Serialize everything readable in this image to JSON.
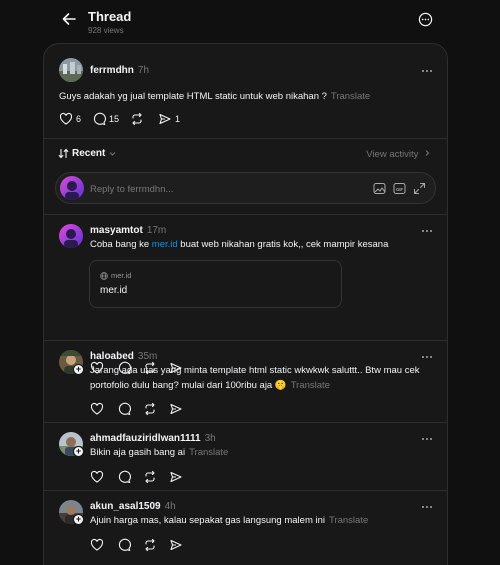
{
  "header": {
    "title": "Thread",
    "views": "928 views"
  },
  "main_post": {
    "username": "ferrmdhn",
    "time": "7h",
    "text": "Guys adakah yg jual template HTML static untuk web nikahan ?",
    "translate": "Translate",
    "likes": "6",
    "comments": "15",
    "shares": "1"
  },
  "sort": {
    "label": "Recent",
    "view_activity": "View activity"
  },
  "reply_box": {
    "placeholder": "Reply to ferrmdhn..."
  },
  "replies": [
    {
      "username": "masyamtot",
      "time": "17m",
      "text_before": "Coba bang ke ",
      "link_text": "mer.id",
      "text_after": " buat web nikahan gratis kok,, cek mampir kesana",
      "link_card": {
        "domain": "mer.id",
        "title": "mer.id"
      }
    },
    {
      "username": "haloabed",
      "time": "35m",
      "text": "Jarang ada utas yang minta template html static wkwkwk saluttt.. Btw mau cek portofolio dulu bang? mulai dari 100ribu aja 🤫",
      "translate": "Translate"
    },
    {
      "username": "ahmadfauziridlwan1111",
      "time": "3h",
      "text": "Bikin aja gasih bang ai",
      "translate": "Translate"
    },
    {
      "username": "akun_asal1509",
      "time": "4h",
      "text": "Ajuin harga mas, kalau sepakat gas langsung malem ini",
      "translate": "Translate"
    }
  ],
  "colors": {
    "background": "#101010",
    "card": "#181818",
    "link": "#0095f6",
    "muted": "#777777"
  }
}
